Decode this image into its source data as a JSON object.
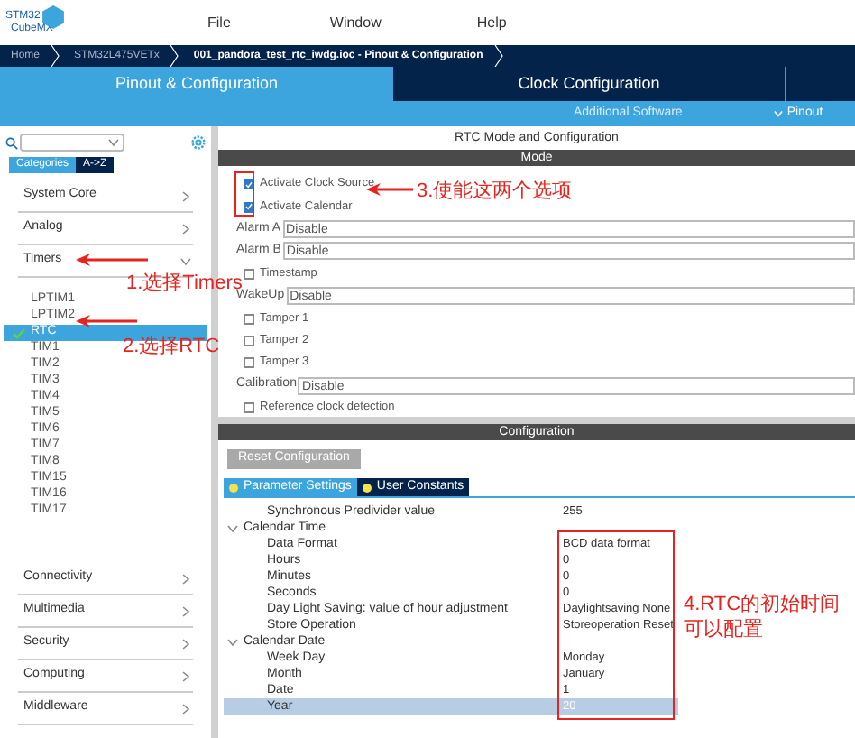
{
  "menu": [
    "File",
    "Window",
    "Help"
  ],
  "logo": {
    "line1": "STM32",
    "line2": "CubeMX"
  },
  "breadcrumb": [
    {
      "label": "Home",
      "current": false
    },
    {
      "label": "STM32L475VETx",
      "current": false
    },
    {
      "label": "001_pandora_test_rtc_iwdg.ioc - Pinout & Configuration",
      "current": true
    }
  ],
  "tabs": [
    {
      "label": "Pinout & Configuration",
      "selected": true
    },
    {
      "label": "Clock Configuration",
      "selected": false
    }
  ],
  "subtabs": [
    "Additional Software",
    "Pinout"
  ],
  "sidebar": {
    "view_tabs": [
      {
        "label": "Categories",
        "selected": true
      },
      {
        "label": "A->Z",
        "selected": false
      }
    ],
    "categories": [
      {
        "label": "System Core",
        "expanded": false
      },
      {
        "label": "Analog",
        "expanded": false
      },
      {
        "label": "Timers",
        "expanded": true,
        "children": [
          {
            "label": "LPTIM1",
            "selected": false,
            "checked": false
          },
          {
            "label": "LPTIM2",
            "selected": false,
            "checked": false
          },
          {
            "label": "RTC",
            "selected": true,
            "checked": true
          },
          {
            "label": "TIM1",
            "selected": false,
            "checked": false
          },
          {
            "label": "TIM2",
            "selected": false,
            "checked": false
          },
          {
            "label": "TIM3",
            "selected": false,
            "checked": false
          },
          {
            "label": "TIM4",
            "selected": false,
            "checked": false
          },
          {
            "label": "TIM5",
            "selected": false,
            "checked": false
          },
          {
            "label": "TIM6",
            "selected": false,
            "checked": false
          },
          {
            "label": "TIM7",
            "selected": false,
            "checked": false
          },
          {
            "label": "TIM8",
            "selected": false,
            "checked": false
          },
          {
            "label": "TIM15",
            "selected": false,
            "checked": false
          },
          {
            "label": "TIM16",
            "selected": false,
            "checked": false
          },
          {
            "label": "TIM17",
            "selected": false,
            "checked": false
          }
        ]
      },
      {
        "label": "Connectivity",
        "expanded": false
      },
      {
        "label": "Multimedia",
        "expanded": false
      },
      {
        "label": "Security",
        "expanded": false
      },
      {
        "label": "Computing",
        "expanded": false
      },
      {
        "label": "Middleware",
        "expanded": false
      }
    ]
  },
  "panel_title": "RTC Mode and Configuration",
  "mode": {
    "header": "Mode",
    "rows": [
      {
        "kind": "checkbox",
        "label": "Activate Clock Source",
        "checked": true
      },
      {
        "kind": "checkbox",
        "label": "Activate Calendar",
        "checked": true
      },
      {
        "kind": "select",
        "label": "Alarm A",
        "value": "Disable"
      },
      {
        "kind": "select",
        "label": "Alarm B",
        "value": "Disable"
      },
      {
        "kind": "checkbox",
        "label": "Timestamp",
        "checked": false
      },
      {
        "kind": "select",
        "label": "WakeUp",
        "value": "Disable"
      },
      {
        "kind": "checkbox",
        "label": "Tamper 1",
        "checked": false
      },
      {
        "kind": "checkbox",
        "label": "Tamper 2",
        "checked": false
      },
      {
        "kind": "checkbox",
        "label": "Tamper 3",
        "checked": false
      },
      {
        "kind": "select",
        "label": "Calibration",
        "value": "Disable"
      },
      {
        "kind": "checkbox",
        "label": "Reference clock detection",
        "checked": false
      }
    ]
  },
  "configuration": {
    "header": "Configuration",
    "reset_button": "Reset Configuration",
    "tabs": [
      {
        "label": "Parameter Settings",
        "selected": true
      },
      {
        "label": "User Constants",
        "selected": false
      }
    ],
    "tree": [
      {
        "label": "Synchronous Predivider value",
        "value": "255",
        "selected": false
      },
      {
        "label": "Calendar Time",
        "expanded": true,
        "children": [
          {
            "label": "Data Format",
            "value": "BCD data format",
            "selected": false
          },
          {
            "label": "Hours",
            "value": "0",
            "selected": false
          },
          {
            "label": "Minutes",
            "value": "0",
            "selected": false
          },
          {
            "label": "Seconds",
            "value": "0",
            "selected": false
          },
          {
            "label": "Day Light Saving: value of hour adjustment",
            "value": "Daylightsaving None",
            "selected": false
          },
          {
            "label": "Store Operation",
            "value": "Storeoperation Reset",
            "selected": false
          }
        ]
      },
      {
        "label": "Calendar Date",
        "expanded": true,
        "children": [
          {
            "label": "Week Day",
            "value": "Monday",
            "selected": false
          },
          {
            "label": "Month",
            "value": "January",
            "selected": false
          },
          {
            "label": "Date",
            "value": "1",
            "selected": false
          },
          {
            "label": "Year",
            "value": "20",
            "selected": true
          }
        ]
      }
    ]
  },
  "annotations": [
    "1.选择Timers",
    "2.选择RTC",
    "3.使能这两个选项",
    "4.RTC的初始时间可以配置"
  ]
}
